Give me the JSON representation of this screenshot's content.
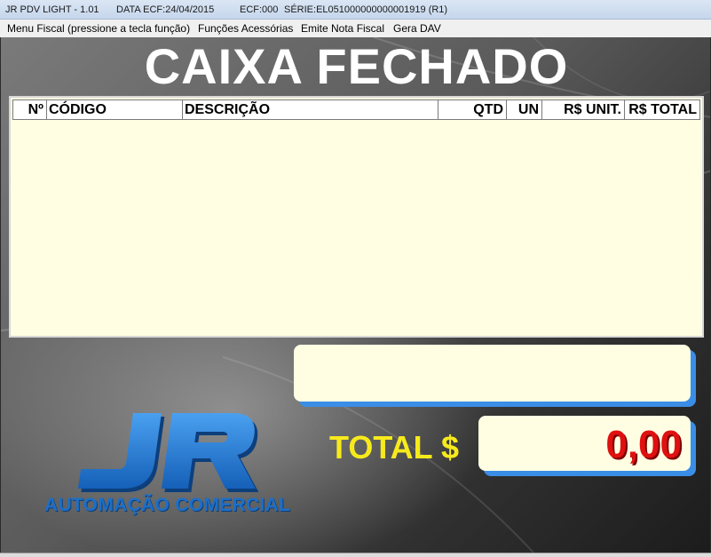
{
  "titlebar": {
    "app": "JR PDV LIGHT - 1.01",
    "date": "DATA ECF:24/04/2015",
    "ecf": "ECF:000",
    "serie": "SÉRIE:EL051000000000001919 (R1)"
  },
  "menu": {
    "items": [
      {
        "label": "Menu Fiscal (pressione a tecla função)"
      },
      {
        "label": "Funções Acessórias"
      },
      {
        "label": "Emite Nota Fiscal"
      },
      {
        "label": "Gera DAV"
      }
    ]
  },
  "main": {
    "status_title": "CAIXA FECHADO"
  },
  "grid": {
    "columns": [
      "Nº",
      "CÓDIGO",
      "DESCRIÇÃO",
      "QTD",
      "UN",
      "R$ UNIT.",
      "R$ TOTAL"
    ],
    "rows": []
  },
  "message": {
    "text": ""
  },
  "total": {
    "label": "TOTAL $",
    "value": "0,00"
  },
  "logo": {
    "letters": "JR",
    "tagline": "AUTOMAÇÃO COMERCIAL"
  },
  "colors": {
    "accent_blue": "#3a8ee6",
    "total_yellow": "#f7ea1c",
    "total_red": "#e01010",
    "grid_background": "#fffee3"
  }
}
